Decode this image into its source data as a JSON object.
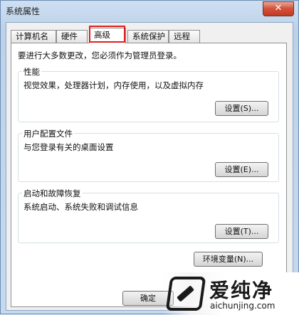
{
  "window": {
    "title": "系统属性",
    "close_symbol": "✕"
  },
  "tabs": [
    {
      "label": "计算机名"
    },
    {
      "label": "硬件"
    },
    {
      "label": "高级",
      "active": true
    },
    {
      "label": "系统保护"
    },
    {
      "label": "远程"
    }
  ],
  "advanced": {
    "admin_note": "要进行大多数更改，您必须作为管理员登录。",
    "performance": {
      "title": "性能",
      "description": "视觉效果，处理器计划，内存使用，以及虚拟内存",
      "button": "设置(S)..."
    },
    "user_profiles": {
      "title": "用户配置文件",
      "description": "与您登录有关的桌面设置",
      "button": "设置(E)..."
    },
    "startup_recovery": {
      "title": "启动和故障恢复",
      "description": "系统启动、系统失败和调试信息",
      "button": "设置(T)..."
    },
    "env_button": "环境变量(N)..."
  },
  "footer": {
    "ok_label": "确定"
  },
  "watermark": {
    "brand": "爱纯净",
    "url": "aichunjing.com"
  },
  "colors": {
    "highlight_box": "#e02020",
    "close_button": "#c13a22",
    "title_bar": "#bcd2ea"
  },
  "icons": {
    "close": "close-icon",
    "watermark_logo": "aichunjing-logo"
  }
}
